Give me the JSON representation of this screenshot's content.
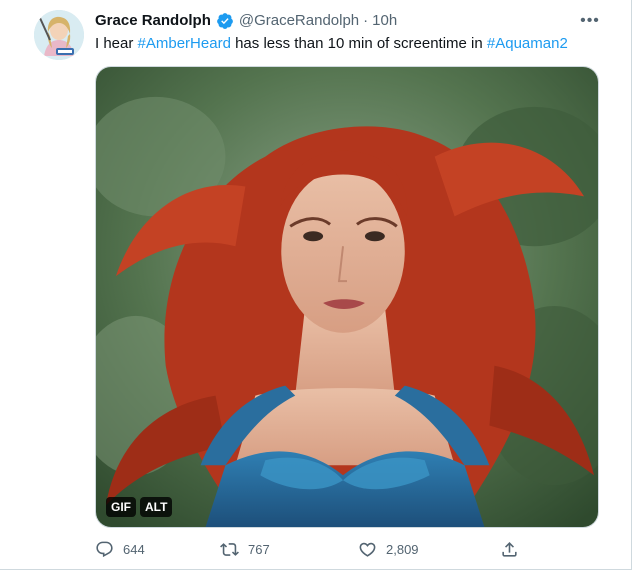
{
  "tweet": {
    "author_name": "Grace Randolph",
    "handle": "@GraceRandolph",
    "separator": "·",
    "time": "10h",
    "more_label": "•••",
    "text_parts": [
      "I hear ",
      "#AmberHeard",
      " has less than 10 min of screentime in ",
      "#Aquaman2"
    ]
  },
  "media": {
    "badges": [
      "GIF",
      "ALT"
    ]
  },
  "actions": {
    "replies": "644",
    "retweets": "767",
    "likes": "2,809"
  },
  "colors": {
    "accent": "#1d9bf0",
    "secondary_text": "#536471",
    "primary_text": "#0f1419"
  },
  "icons": [
    "verified-badge-icon",
    "more-icon",
    "reply-icon",
    "retweet-icon",
    "like-icon",
    "share-icon"
  ]
}
